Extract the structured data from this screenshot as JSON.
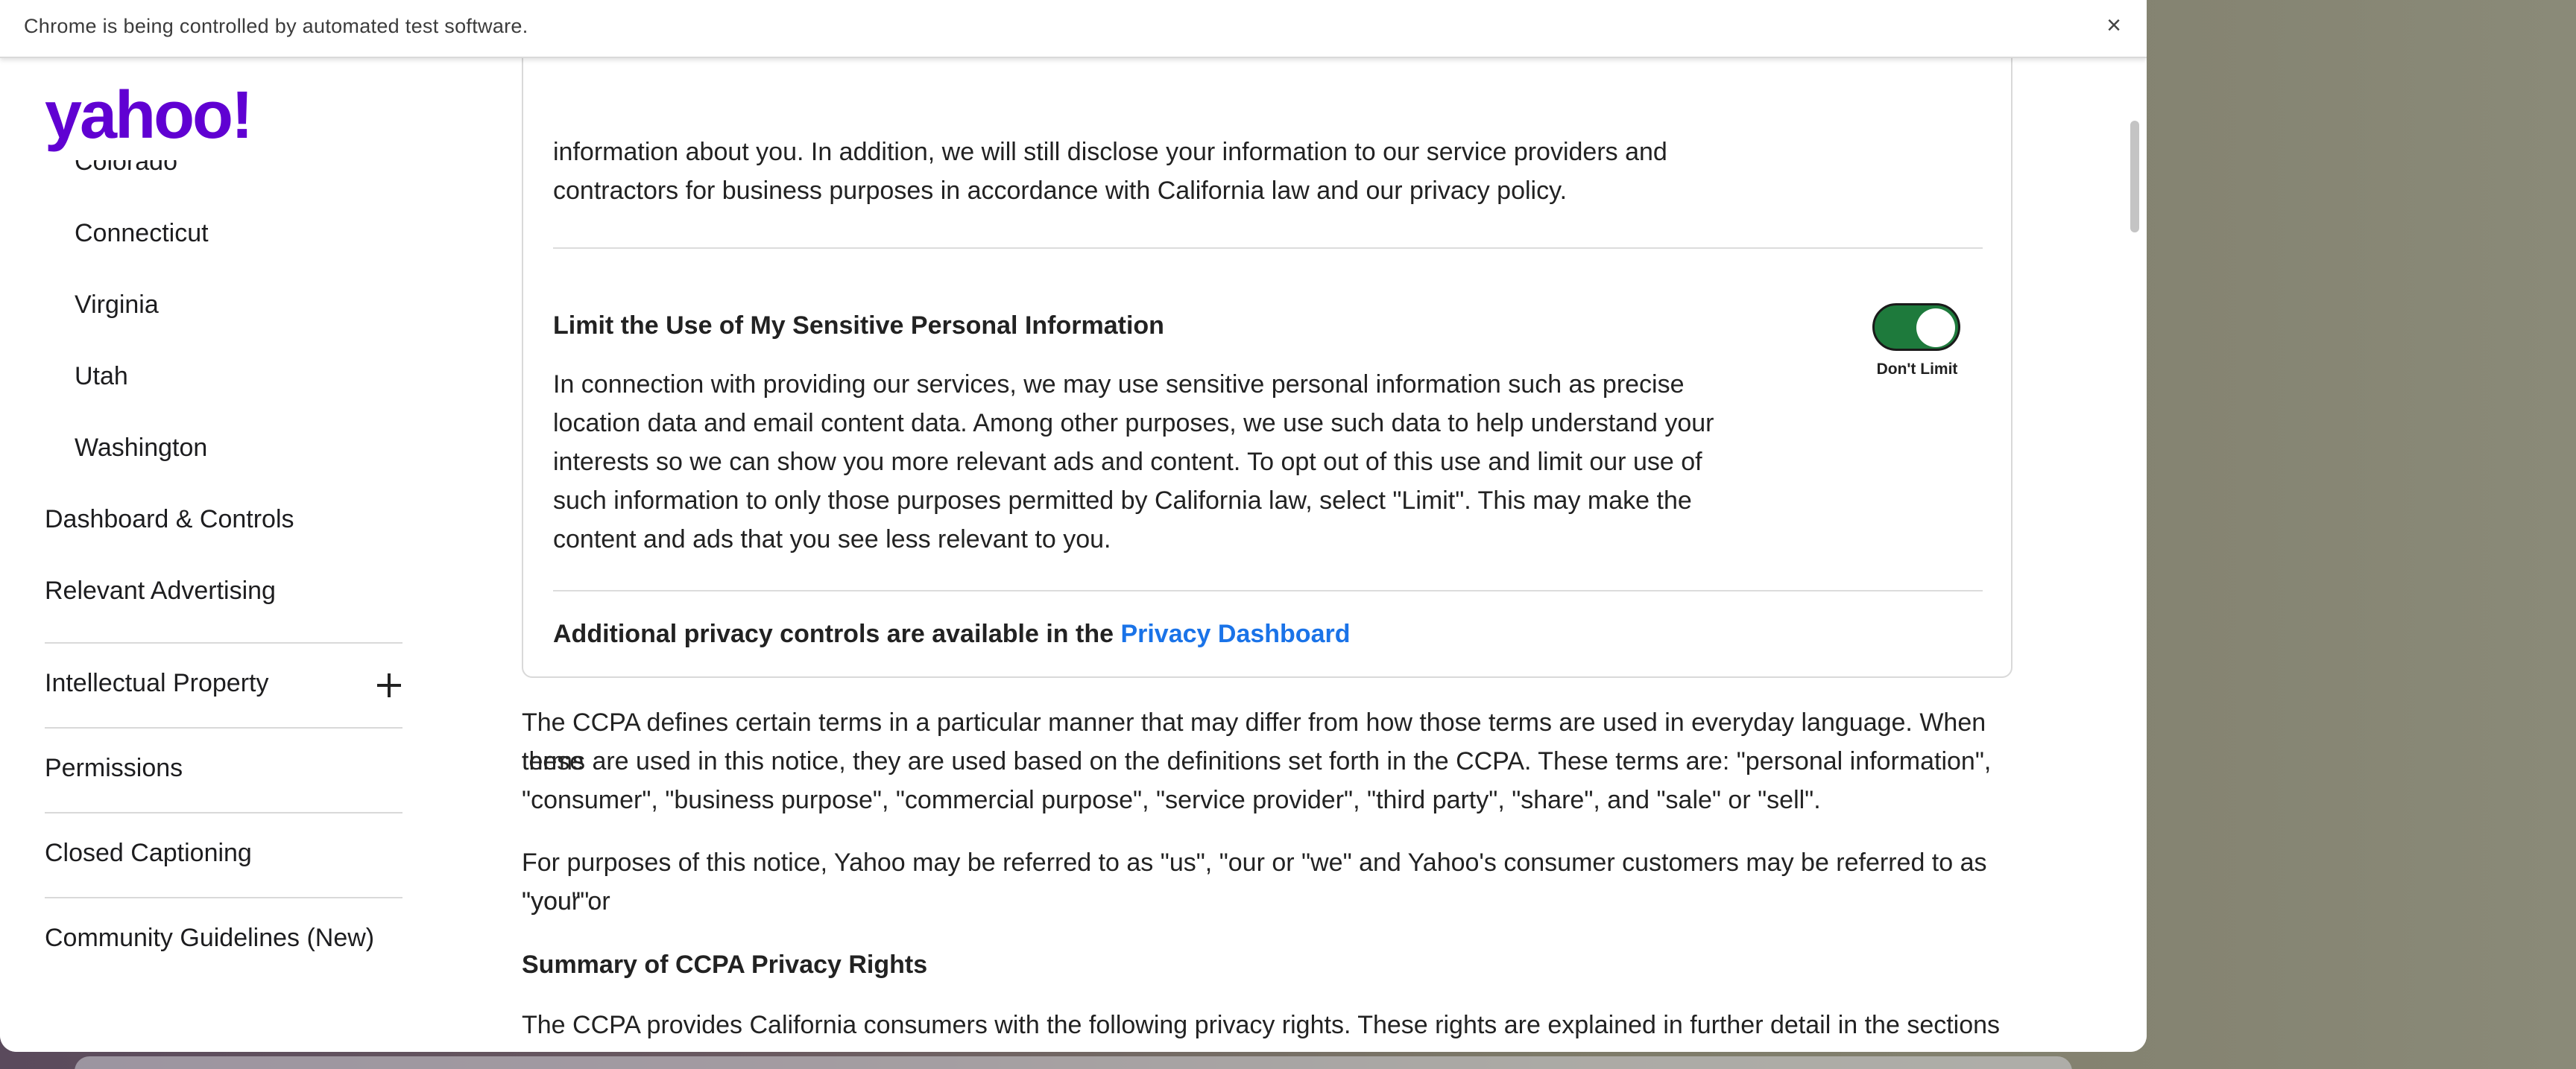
{
  "infobar": {
    "message": "Chrome is being controlled by automated test software.",
    "close_glyph": "×"
  },
  "logo": {
    "text": "yahoo!",
    "color": "#6001d2"
  },
  "sidebar": {
    "sub_items": [
      "Colorado",
      "Connecticut",
      "Virginia",
      "Utah",
      "Washington"
    ],
    "main_items": [
      {
        "label": "Dashboard & Controls"
      },
      {
        "label": "Relevant Advertising"
      },
      {
        "label": "Intellectual Property",
        "expand_icon": "plus-icon"
      },
      {
        "label": "Permissions"
      },
      {
        "label": "Closed Captioning"
      },
      {
        "label": "Community Guidelines (New)"
      }
    ]
  },
  "card": {
    "top_para_line1": "information about you. In addition, we will still disclose your information to our service providers and",
    "top_para_line2": "contractors for business purposes in accordance with California law and our privacy policy.",
    "sensitive_heading": "Limit the Use of My Sensitive Personal Information",
    "sensitive_body": [
      "In connection with providing our services, we may use sensitive personal information such as precise",
      "location data and email content data. Among other purposes, we use such data to help understand your",
      "interests so we can show you more relevant ads and content. To opt out of this use and limit our use of",
      "such information to only those purposes permitted by California law, select \"Limit\". This may make the",
      "content and ads that you see less relevant to you."
    ],
    "toggle": {
      "label": "Don't Limit",
      "state": "on",
      "color": "#1e7a3c"
    },
    "footer_text": "Additional privacy controls are available in the ",
    "footer_link": "Privacy Dashboard",
    "link_color": "#1a73e8"
  },
  "body": {
    "definitions": [
      "The CCPA defines certain terms in a particular manner that may differ from how those terms are used in everyday language. When these",
      "terms are used in this notice, they are used based on the definitions set forth in the CCPA. These terms are: \"personal information\",",
      "\"consumer\", \"business purpose\", \"commercial purpose\", \"service provider\", \"third party\", \"share\", and \"sale\" or \"sell\"."
    ],
    "purposes": [
      "For purposes of this notice, Yahoo may be referred to as \"us\", \"our or \"we\" and Yahoo's consumer customers may be referred to as \"you\" or",
      "\"your\"."
    ],
    "summary_heading": "Summary of CCPA Privacy Rights",
    "summary_intro": "The CCPA provides California consumers with the following privacy rights. These rights are explained in further detail in the sections below."
  }
}
